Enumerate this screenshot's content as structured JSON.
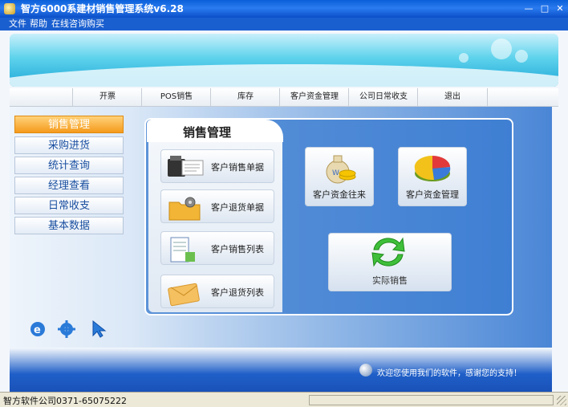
{
  "window": {
    "title": "智方6000系建材销售管理系统v6.28",
    "controls": {
      "minimize": "—",
      "maximize": "□",
      "close": "✕"
    }
  },
  "menu": [
    "文件",
    "帮助",
    "在线咨询购买"
  ],
  "nav": [
    "开票",
    "POS销售",
    "库存",
    "客户资金管理",
    "公司日常收支",
    "退出"
  ],
  "sidebar": {
    "active_index": 0,
    "items": [
      "销售管理",
      "采购进货",
      "统计查询",
      "经理查看",
      "日常收支",
      "基本数据"
    ]
  },
  "panel": {
    "title": "销售管理",
    "tiles": [
      {
        "label": "客户销售单据",
        "icon": "cash-register-icon"
      },
      {
        "label": "客户退货单据",
        "icon": "folder-gear-icon"
      },
      {
        "label": "客户销售列表",
        "icon": "document-list-icon"
      },
      {
        "label": "客户退货列表",
        "icon": "envelope-list-icon"
      }
    ],
    "big_tiles": [
      {
        "label": "客户资金往来",
        "icon": "money-bag-icon"
      },
      {
        "label": "客户资金管理",
        "icon": "pie-chart-icon"
      },
      {
        "label": "实际销售",
        "icon": "refresh-arrows-icon"
      }
    ]
  },
  "quick_icons": [
    "internet-explorer-icon",
    "settings-icon",
    "pointer-icon"
  ],
  "footer": {
    "welcome": "欢迎您使用我们的软件，感谢您的支持！"
  },
  "statusbar": {
    "text": "智方软件公司0371-65075222"
  }
}
